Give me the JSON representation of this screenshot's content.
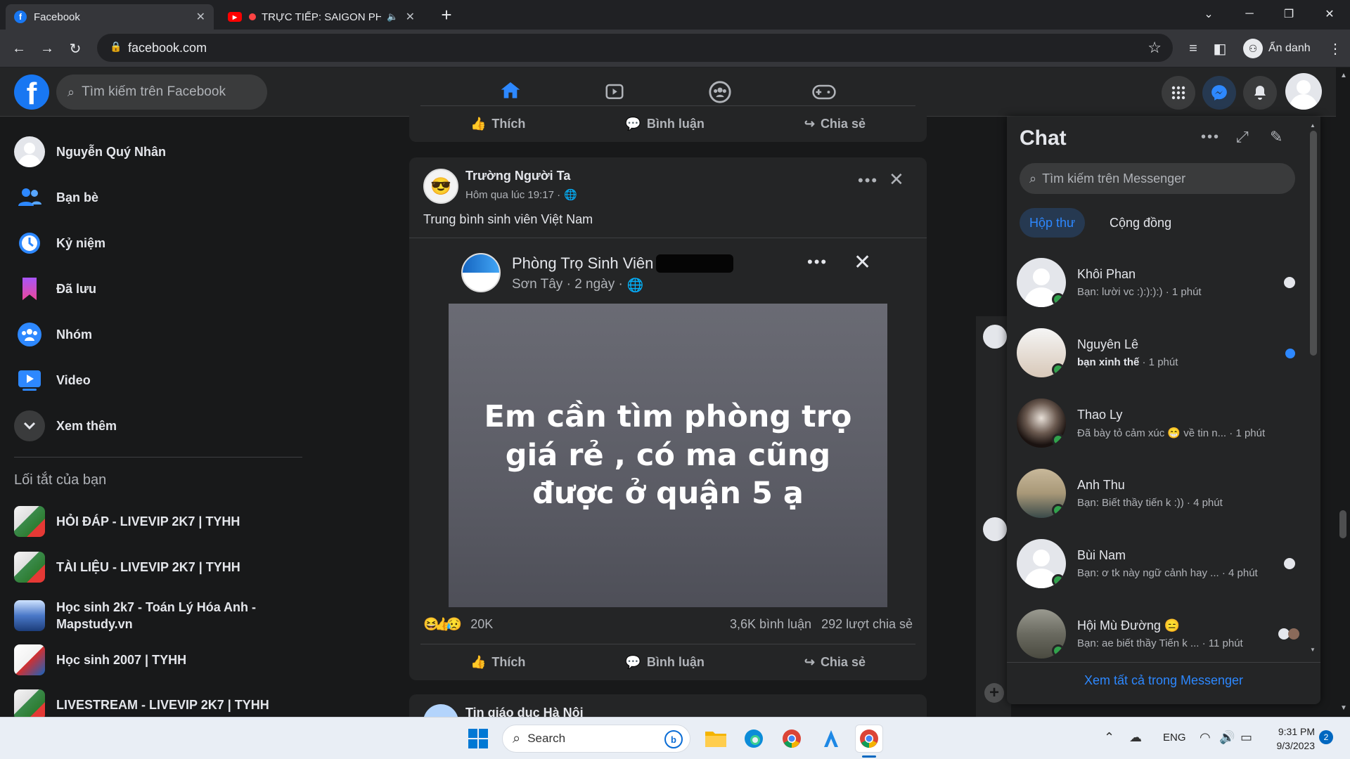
{
  "browser": {
    "tabs": [
      {
        "title": "Facebook",
        "active": true
      },
      {
        "title": "TRỰC TIẾP: SAIGON PHA",
        "active": false
      }
    ],
    "new_tab": "+",
    "url": "facebook.com",
    "profile_label": "Ẩn danh"
  },
  "fb_header": {
    "logo": "f",
    "search_placeholder": "Tìm kiếm trên Facebook"
  },
  "sidebar": {
    "user": "Nguyễn Quý Nhân",
    "items": [
      {
        "label": "Bạn bè",
        "icon": "friends-icon"
      },
      {
        "label": "Kỷ niệm",
        "icon": "memories-icon"
      },
      {
        "label": "Đã lưu",
        "icon": "saved-icon"
      },
      {
        "label": "Nhóm",
        "icon": "groups-icon"
      },
      {
        "label": "Video",
        "icon": "video-icon"
      },
      {
        "label": "Xem thêm",
        "icon": "chevron-down-icon"
      }
    ],
    "shortcuts_title": "Lối tắt của bạn",
    "shortcuts": [
      "HỎI ĐÁP - LIVEVIP 2K7 | TYHH",
      "TÀI LIỆU - LIVEVIP 2K7 | TYHH",
      "Học sinh 2k7 - Toán Lý Hóa Anh - Mapstudy.vn",
      "Học sinh 2007 | TYHH",
      "LIVESTREAM - LIVEVIP 2K7 | TYHH"
    ]
  },
  "actions": {
    "like": "Thích",
    "comment": "Bình luận",
    "share": "Chia sẻ"
  },
  "post": {
    "author": "Trường Người Ta",
    "time": "Hôm qua lúc 19:17 ·",
    "text": "Trung bình sinh viên Việt Nam",
    "shared": {
      "author": "Phòng Trọ Sinh Viên",
      "meta": "Sơn Tây · 2 ngày ·",
      "image_text": "Em cần tìm phòng trọ giá rẻ , có ma cũng được ở quận 5 ạ"
    },
    "reactions": "20K",
    "comments": "3,6K bình luận",
    "shares": "292 lượt chia sẻ"
  },
  "next_post_author": "Tin giáo dục Hà Nội",
  "chat": {
    "title": "Chat",
    "search_placeholder": "Tìm kiếm trên Messenger",
    "tabs": [
      "Hộp thư",
      "Cộng đồng"
    ],
    "conversations": [
      {
        "name": "Khôi Phan",
        "message": "Bạn: lười vc :):):):)",
        "time": "· 1 phút",
        "unread": false
      },
      {
        "name": "Nguyên Lê",
        "message": "bạn xinh thế",
        "time": "· 1 phút",
        "unread": true
      },
      {
        "name": "Thao Ly",
        "message": "Đã bày tỏ cảm xúc 😁 về tin n...",
        "time": "· 1 phút",
        "unread": false
      },
      {
        "name": "Anh Thu",
        "message": "Bạn: Biết thầy tiến k :))",
        "time": "· 4 phút",
        "unread": false
      },
      {
        "name": "Bùi Nam",
        "message": "Bạn: ơ tk này ngữ cảnh hay ...",
        "time": "· 4 phút",
        "unread": false
      },
      {
        "name": "Hội Mù Đường 😑",
        "message": "Bạn: ae biết thầy Tiến k ...",
        "time": "· 11 phút",
        "unread": false
      }
    ],
    "see_all": "Xem tất cả trong Messenger"
  },
  "taskbar": {
    "search": "Search",
    "lang": "ENG",
    "time": "9:31 PM",
    "date": "9/3/2023",
    "notif_count": "2"
  },
  "colors": {
    "accent": "#2d88ff",
    "fb_blue": "#1877f2",
    "online": "#31a24c"
  }
}
